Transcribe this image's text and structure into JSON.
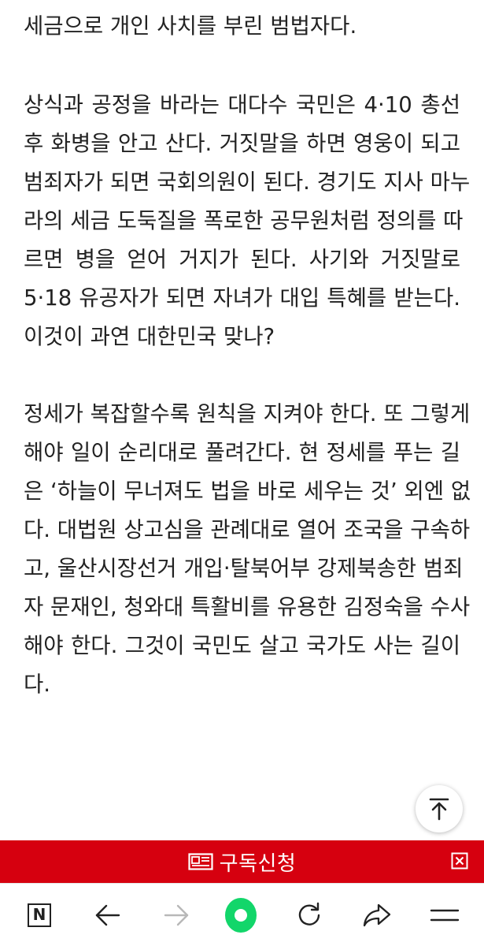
{
  "article": {
    "lines": [
      "세금으로 개인 사치를 부린 범법자다.",
      "상식과 공정을 바라는 대다수 국민은 4·10 총선",
      "후 화병을 안고 산다. 거짓말을 하면 영웅이 되고",
      "범죄자가 되면 국회의원이 된다. 경기도 지사 마누",
      "라의 세금 도둑질을 폭로한 공무원처럼 정의를 따",
      "르면 병을 얻어 거지가 된다. 사기와 거짓말로",
      "5·18 유공자가 되면 자녀가 대입 특혜를 받는다.",
      "이것이 과연 대한민국 맞나?",
      "정세가 복잡할수록 원칙을 지켜야 한다. 또 그렇게",
      "해야 일이 순리대로 풀려간다. 현 정세를 푸는 길",
      "은 ‘하늘이 무너져도 법을 바로 세우는 것’ 외엔 없",
      "다. 대법원 상고심을 관례대로 열어 조국을 구속하",
      "고, 울산시장선거 개입·탈북어부 강제북송한 범죄",
      "자 문재인, 청와대 특활비를 유용한 김정숙을 수사",
      "해야 한다. 그것이 국민도 살고 국가도 사는 길이",
      "다."
    ]
  },
  "scroll_top": {
    "icon": "arrow-up-to-top-icon"
  },
  "subscribe_bar": {
    "label": "구독신청",
    "icon": "newspaper-icon",
    "close_icon": "close-box-icon",
    "color": "#d6000f"
  },
  "nav_bar": {
    "n_label": "N",
    "items": [
      "naver-n-icon",
      "back-arrow-icon",
      "forward-arrow-icon",
      "home-dot-icon",
      "refresh-icon",
      "share-icon",
      "menu-icon"
    ],
    "accent": "#12d66a"
  }
}
